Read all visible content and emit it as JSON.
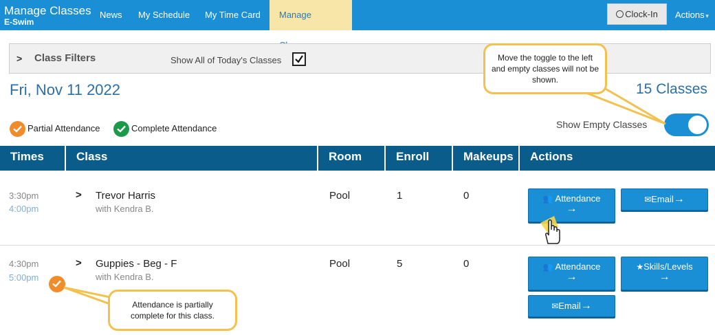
{
  "nav": {
    "title": "Manage Classes",
    "subtitle": "E-Swim",
    "links": [
      "News",
      "My Schedule",
      "My Time Card",
      "Manage Classes"
    ],
    "clockin": "Clock-In",
    "actions": "Actions"
  },
  "filters": {
    "title": "Class Filters",
    "show_all_label": "Show All of Today's Classes",
    "show_all_checked": true
  },
  "date": "Fri, Nov 11 2022",
  "class_count": "15 Classes",
  "legend": {
    "partial": "Partial Attendance",
    "complete": "Complete Attendance"
  },
  "toggle": {
    "label": "Show Empty Classes",
    "on": true
  },
  "columns": [
    "Times",
    "Class",
    "Room",
    "Enroll",
    "Makeups",
    "Actions"
  ],
  "rows": [
    {
      "start": "3:30pm",
      "end": "4:00pm",
      "name": "Trevor Harris",
      "with": "with Kendra B.",
      "room": "Pool",
      "enroll": "1",
      "makeups": "0",
      "btn_attendance": "Attendance",
      "btn_email": "Email"
    },
    {
      "start": "4:30pm",
      "end": "5:00pm",
      "name": "Guppies - Beg - F",
      "with": "with Kendra B.",
      "room": "Pool",
      "enroll": "5",
      "makeups": "0",
      "btn_attendance": "Attendance",
      "btn_skills": "Skills/Levels",
      "btn_email": "Email"
    }
  ],
  "callouts": {
    "toggle_tip": "Move the toggle to the left and empty classes will not be shown.",
    "partial_tip": "Attendance is partially complete for this class."
  },
  "colors": {
    "nav_blue": "#1a8fd6",
    "header_dark": "#0a5c8a",
    "active_tab": "#f8e6a8",
    "partial_orange": "#f08c2a",
    "complete_green": "#1c9a4b",
    "callout_border": "#f2c14e"
  },
  "icons": [
    "clock-icon",
    "chevron-right-icon",
    "checkbox-checked-icon",
    "check-icon",
    "users-icon",
    "envelope-icon",
    "star-icon",
    "arrow-right-icon",
    "hand-cursor-icon"
  ]
}
